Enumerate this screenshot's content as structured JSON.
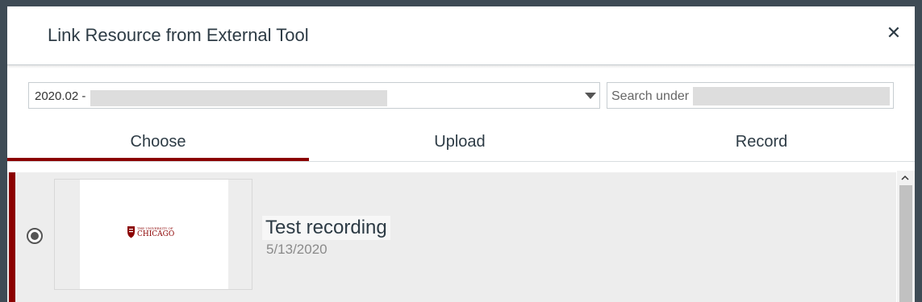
{
  "dialog": {
    "title": "Link Resource from External Tool",
    "close_icon": "close-icon"
  },
  "folder_select": {
    "value": "2020.02 -",
    "icon": "chevron-down-icon"
  },
  "search": {
    "label": "Search under"
  },
  "tabs": [
    {
      "label": "Choose",
      "active": true
    },
    {
      "label": "Upload",
      "active": false
    },
    {
      "label": "Record",
      "active": false
    }
  ],
  "media_list": {
    "items": [
      {
        "title": "Test recording",
        "date": "5/13/2020",
        "selected": true,
        "thumbnail_logo": {
          "line1": "THE UNIVERSITY OF",
          "line2": "CHICAGO"
        }
      }
    ]
  },
  "colors": {
    "accent": "#8b0000",
    "text": "#2d3b45",
    "muted": "#8a8a8a",
    "backdrop": "#3e4b55"
  }
}
